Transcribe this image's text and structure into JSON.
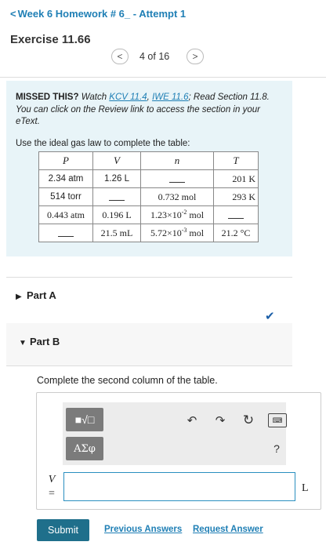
{
  "nav": {
    "back_chevron": "<",
    "back_label": "Week 6 Homework # 6_ - Attempt 1"
  },
  "exercise": {
    "title": "Exercise 11.66"
  },
  "pager": {
    "prev_icon": "<",
    "next_icon": ">",
    "count": "4 of 16"
  },
  "missed": {
    "lead": "MISSED THIS?",
    "watch": " Watch ",
    "link1": "KCV 11.4",
    "sep": ", ",
    "link2": "IWE 11.6",
    "rest1": "; Read Section 11.8. You can click on the Review link to access the section in your eText."
  },
  "table": {
    "caption": "Use the ideal gas law to complete the table:",
    "headers": [
      "P",
      "V",
      "n",
      "T"
    ],
    "rows": [
      [
        "2.34 atm",
        "1.26 L",
        "",
        "201 K"
      ],
      [
        "514 torr",
        "",
        "0.732 mol",
        "293 K"
      ],
      [
        "0.443 atm",
        "0.196 L",
        "1.23×10",
        "-2",
        " mol",
        ""
      ],
      [
        "",
        "21.5 mL",
        "5.72×10",
        "-3",
        " mol",
        "21.2 °C"
      ]
    ]
  },
  "parts": {
    "a": {
      "arrow": "▶",
      "label": "Part A",
      "status": "✔"
    },
    "b": {
      "arrow": "▼",
      "label": "Part B"
    }
  },
  "question": {
    "instruction": "Complete the second column of the table.",
    "templates_icon": "■√□",
    "greek_label": "ΑΣφ",
    "undo_icon": "↶",
    "redo_icon": "↷",
    "reset_icon": "↻",
    "keyboard_icon": "⌨",
    "help_icon": "?",
    "variable": "V",
    "equals": "=",
    "unit": "L",
    "answer_value": ""
  },
  "actions": {
    "submit": "Submit",
    "previous_answers": "Previous Answers",
    "request_answer": "Request Answer"
  },
  "colors": {
    "link": "#1f7fb5",
    "submit": "#1f6f8b",
    "box": "#e8f4f8",
    "check": "#1b5fa8"
  }
}
